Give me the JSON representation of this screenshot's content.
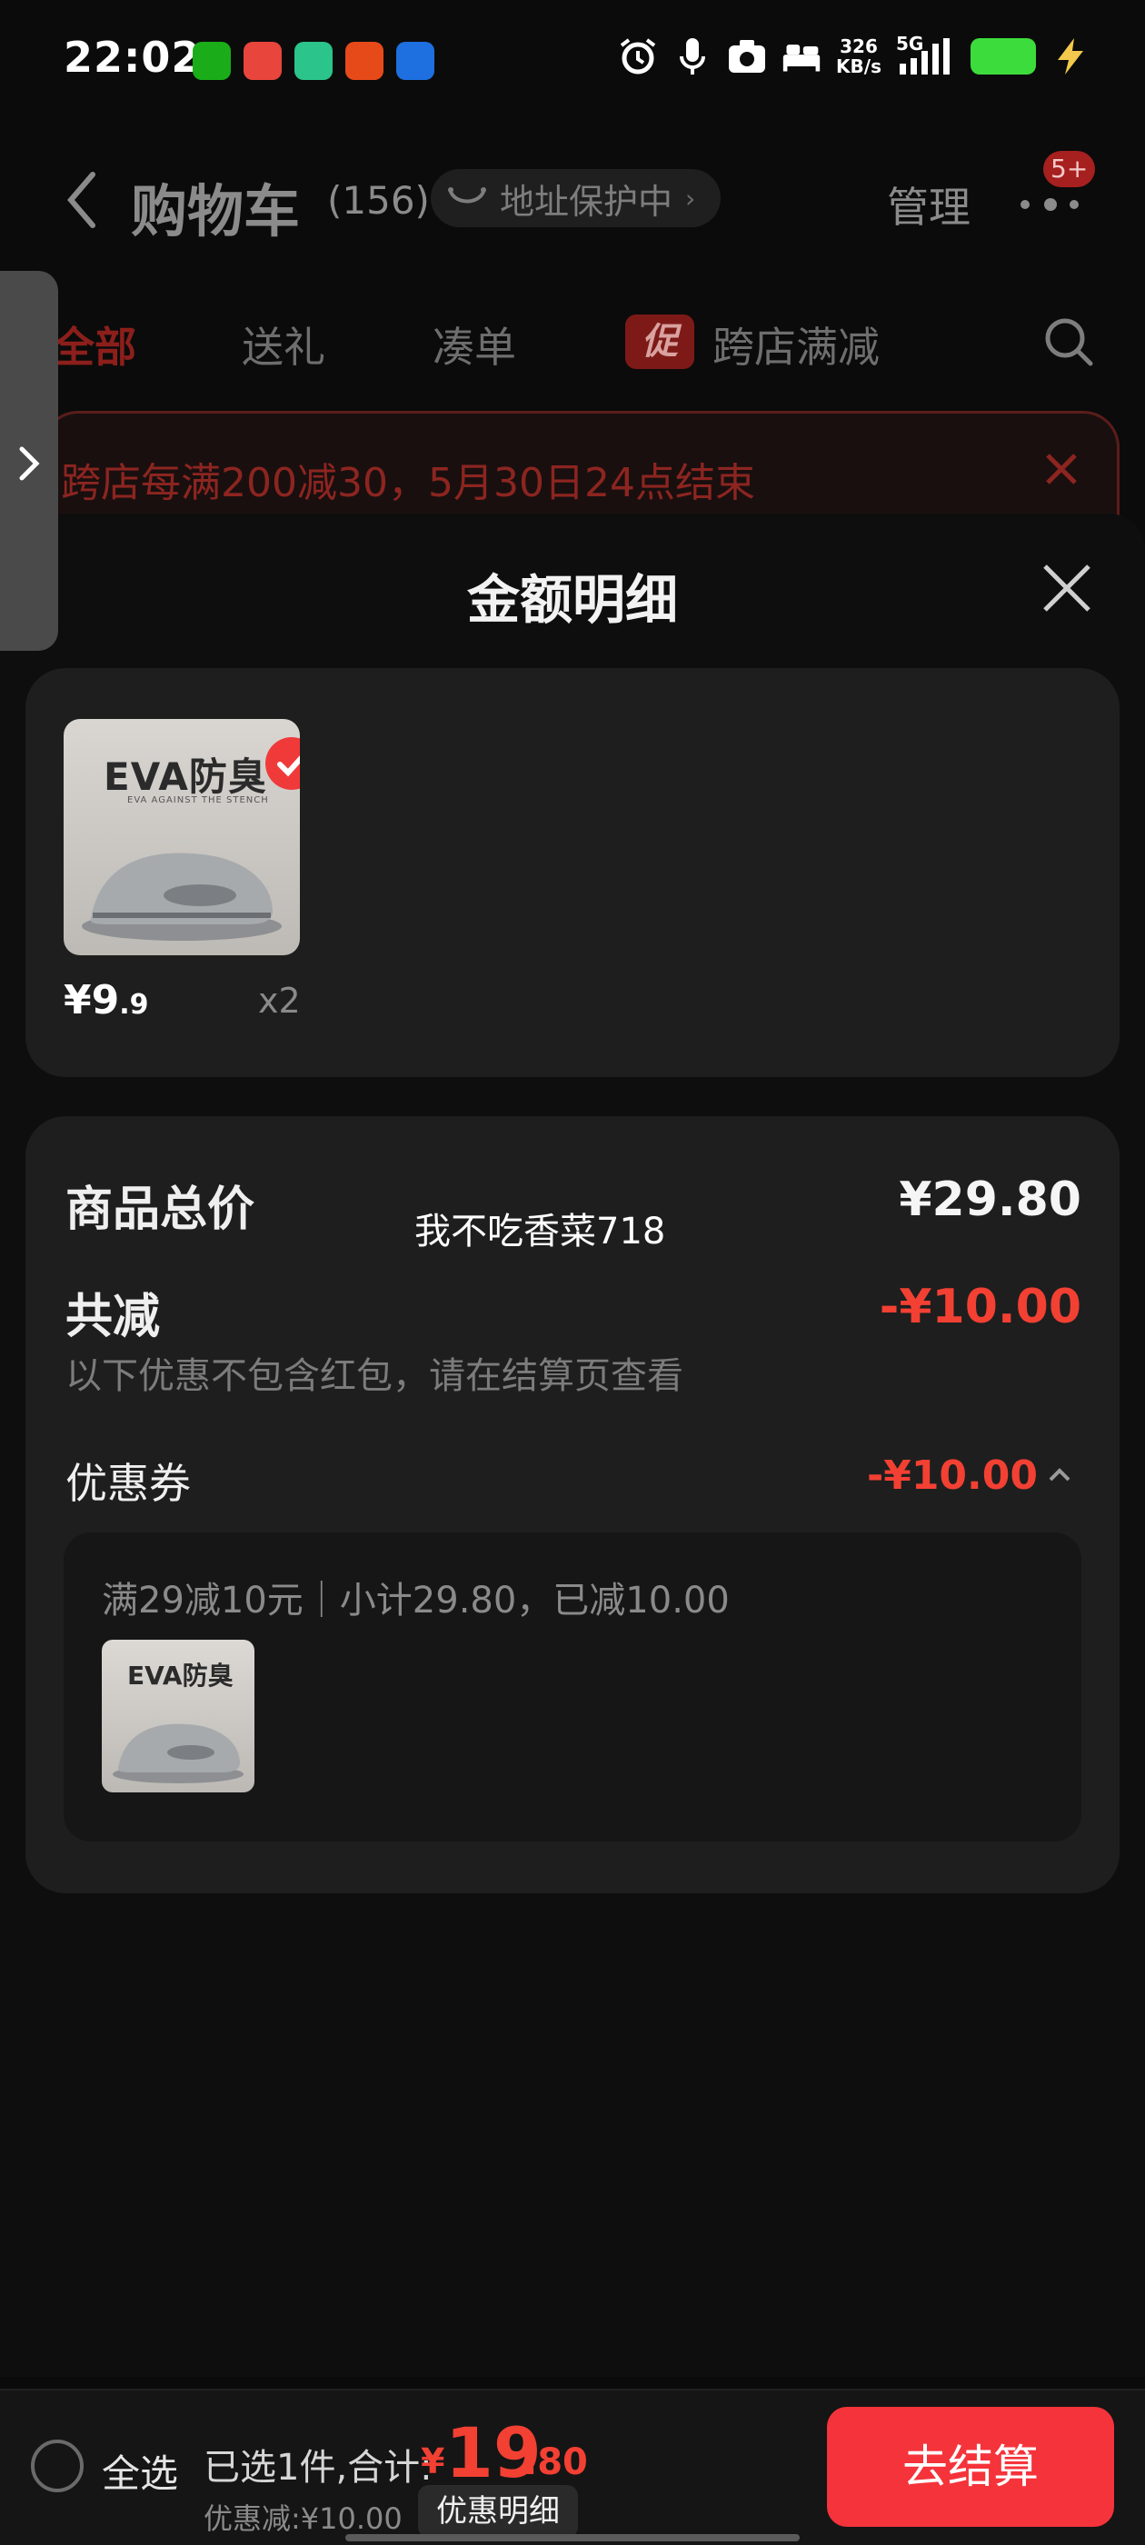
{
  "status_bar": {
    "time": "22:02",
    "net_speed_value": "326",
    "net_speed_unit": "KB/s",
    "signal_label": "5G",
    "battery_color": "#3ddc3d",
    "icons": [
      "wechat-icon",
      "app-icon-red",
      "app-icon-green",
      "app-icon-orange",
      "app-icon-blue",
      "alarm-icon",
      "mic-icon",
      "camera-icon",
      "bed-icon",
      "signal-icon",
      "battery-icon",
      "charging-icon"
    ]
  },
  "header": {
    "title": "购物车",
    "count": "(156)",
    "address_pill": "地址保护中",
    "manage": "管理",
    "badge": "5+"
  },
  "tabs": [
    {
      "label": "全部",
      "active": true
    },
    {
      "label": "送礼"
    },
    {
      "label": "凑单"
    },
    {
      "label": "跨店满减",
      "tag": "促"
    }
  ],
  "promo_banner": {
    "text": "跨店每满200减30，5月30日24点结束"
  },
  "sheet": {
    "title": "金额明细",
    "item": {
      "thumb_brand": "EVA防臭",
      "thumb_sub": "EVA AGAINST THE STENCH",
      "price_main": "¥9",
      "price_dec": ".9",
      "qty": "x2"
    },
    "detail": {
      "total_label": "商品总价",
      "total_value": "¥29.80",
      "reduce_label": "共减",
      "reduce_value": "-¥10.00",
      "hint": "以下优惠不包含红包，请在结算页查看",
      "coupon_label": "优惠券",
      "coupon_value": "-¥10.00",
      "coupon_desc": "满29减10元｜小计29.80，已减10.00",
      "coupon_thumb_brand": "EVA防臭"
    },
    "overlay_user": "我不吃香菜718"
  },
  "bottom_bar": {
    "select_all": "全选",
    "selected_text": "已选1件,合计:",
    "total_currency": "¥",
    "total_int": "19",
    "total_dec": ".80",
    "discount": "优惠减:¥10.00",
    "detail_toggle": "优惠明细",
    "checkout": "去结算"
  },
  "colors": {
    "accent_red": "#f24033",
    "checkout_red": "#f5333a",
    "background": "#0b0b0b",
    "card": "#1e1e1e"
  }
}
